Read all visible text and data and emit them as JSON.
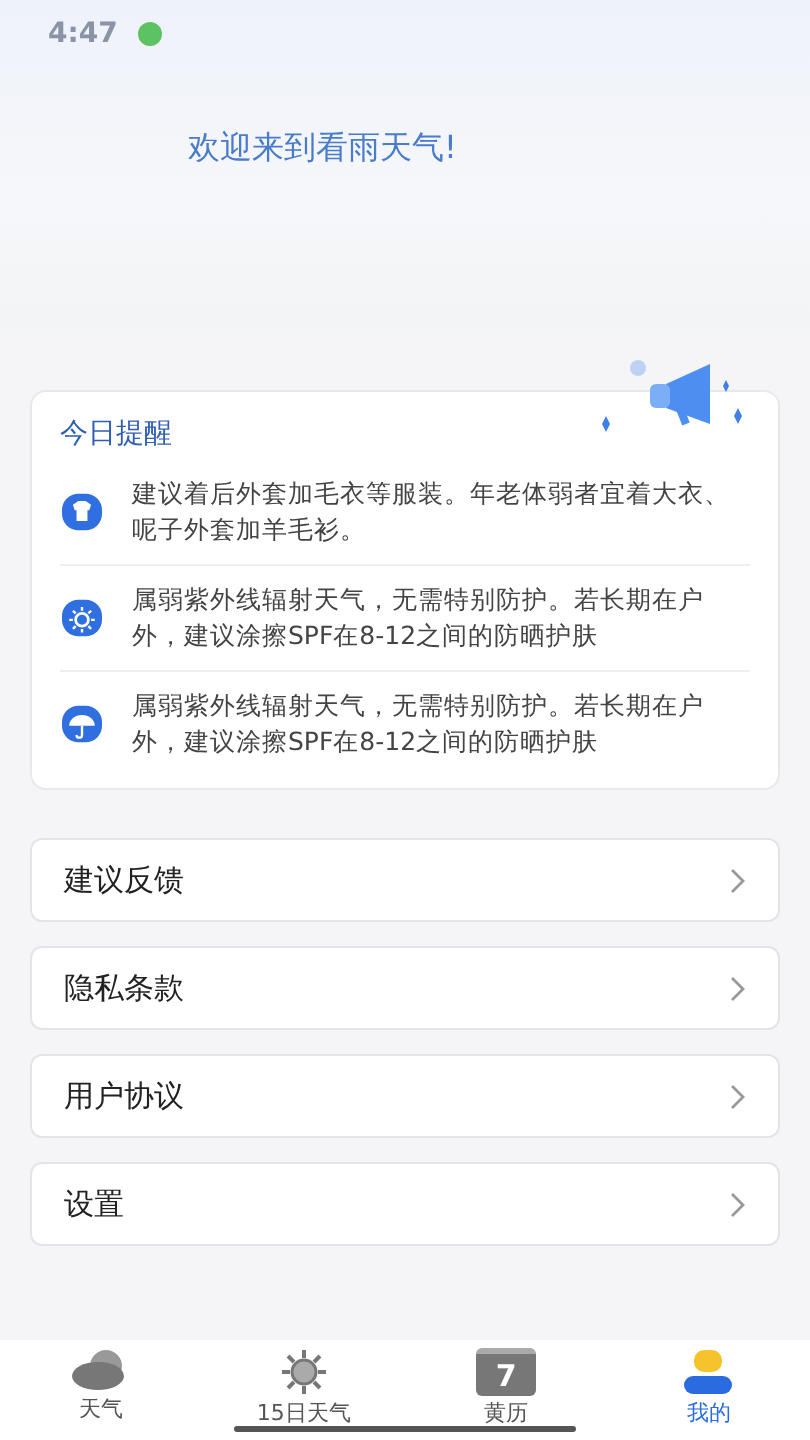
{
  "status_bar": {
    "time": "4:47"
  },
  "welcome": "欢迎来到看雨天气!",
  "reminders": {
    "title": "今日提醒",
    "items": [
      {
        "kind": "shirt",
        "text": "建议着后外套加毛衣等服装。年老体弱者宜着大衣、呢子外套加羊毛衫。"
      },
      {
        "kind": "sun",
        "text": "属弱紫外线辐射天气，无需特别防护。若长期在户外，建议涂擦SPF在8-12之间的防晒护肤"
      },
      {
        "kind": "umbrella",
        "text": "属弱紫外线辐射天气，无需特别防护。若长期在户外，建议涂擦SPF在8-12之间的防晒护肤"
      }
    ]
  },
  "menu": [
    {
      "label": "建议反馈"
    },
    {
      "label": "隐私条款"
    },
    {
      "label": "用户协议"
    },
    {
      "label": "设置"
    }
  ],
  "tabs": [
    {
      "kind": "weather",
      "label": "天气",
      "selected": false
    },
    {
      "kind": "sun",
      "label": "15日天气",
      "selected": false
    },
    {
      "kind": "calendar",
      "label": "黄历",
      "badge": "7",
      "selected": false
    },
    {
      "kind": "me",
      "label": "我的",
      "selected": true
    }
  ]
}
